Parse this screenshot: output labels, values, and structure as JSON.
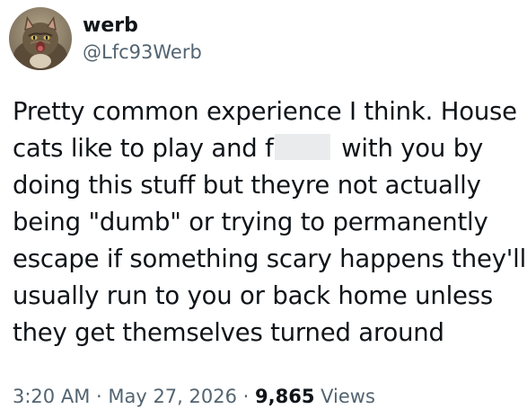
{
  "author": {
    "display_name": "werb",
    "handle": "@Lfc93Werb",
    "avatar_icon": "cat-avatar-icon"
  },
  "tweet": {
    "lines": [
      {
        "before": "Pretty common experience I think. House"
      },
      {
        "before": "cats like to play and f",
        "redacted": true,
        "after": " with you by"
      },
      {
        "before": "doing this stuff but theyre not actually"
      },
      {
        "before": "being \"dumb\" or trying to permanently"
      },
      {
        "before": "escape if something scary happens they'll"
      },
      {
        "before": "usually run to you or back home unless"
      },
      {
        "before": "they get themselves turned around"
      }
    ]
  },
  "meta": {
    "time": "3:20 AM",
    "separator1": " · ",
    "date": "May 27, 2026",
    "separator2": " · ",
    "views_count": "9,865",
    "views_label": " Views"
  },
  "colors": {
    "text_primary": "#0f1419",
    "text_secondary": "#536471",
    "redaction": "#e9ebed"
  }
}
